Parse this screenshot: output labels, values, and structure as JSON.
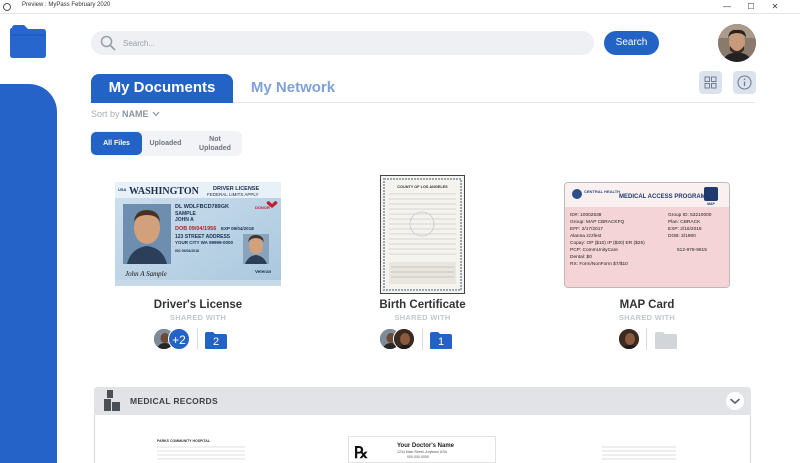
{
  "window": {
    "title": "Preview : MyPass February 2020",
    "minimize_glyph": "—",
    "maximize_glyph": "☐",
    "close_glyph": "✕"
  },
  "search": {
    "placeholder": "Search...",
    "value": "",
    "button_label": "Search"
  },
  "tabs": [
    {
      "label": "My Documents",
      "active": true
    },
    {
      "label": "My Network",
      "active": false
    }
  ],
  "sort": {
    "label": "Sort by",
    "value": "NAME"
  },
  "filters": [
    {
      "label": "All Files",
      "active": true
    },
    {
      "label": "Uploaded",
      "active": false
    },
    {
      "label": "Not Uploaded",
      "active": false
    }
  ],
  "documents": [
    {
      "title": "Driver's License",
      "shared_label": "SHARED WITH",
      "extra_shares": "+2",
      "folder_count": "2",
      "image_text": {
        "state": "WASHINGTON",
        "type": "DRIVER LICENSE",
        "sub": "FEDERAL LIMITS APPLY",
        "dl": "DL WDLFBCD789GK",
        "name1": "SAMPLE",
        "name2": "JOHN A",
        "dob": "DOB 09/04/1956",
        "exp": "EXP 09/04/2018",
        "addr1": "123 STREET ADDRESS",
        "addr2": "YOUR CITY WA 99999-0000",
        "donor": "DONOR",
        "veteran": "Veteran",
        "sig": "John A Sample",
        "iss": "ISS 09/04/2018"
      }
    },
    {
      "title": "Birth Certificate",
      "shared_label": "SHARED WITH",
      "folder_count": "1",
      "image_text": {
        "header": "COUNTY OF LOS ANGELES"
      }
    },
    {
      "title": "MAP Card",
      "shared_label": "SHARED WITH",
      "image_text": {
        "program": "MEDICAL ACCESS PROGRAM",
        "brand": "CENTRAL HEALTH",
        "badge": "MAP",
        "id": "ID#: 10002638",
        "group_id": "Group ID: 53210000",
        "group": "Group: MAP CBRACKFQ",
        "plan": "Plan: CBRACK",
        "eff": "EFF: 2/17/2017",
        "exp": "EXP: 2/16/2018",
        "name": "Alanna zzzfest",
        "dob": "DOB: 3/1980",
        "copay": "Copay: OP ($10) IP ($30) ER ($25)",
        "pcp": "PCP: CommUnityCare",
        "phone": "512-978-9615",
        "dental": "Dental: $0",
        "rx": "RX: Form/NonForm $7/$10"
      }
    }
  ],
  "medical_records": {
    "title": "MEDICAL RECORDS",
    "doc2_title": "Your Doctor's Name",
    "doc2_line1": "1234 Main Street, Anytown USA",
    "doc2_line2": "000-000-0000",
    "doc1_header": "PARKS COMMUNITY HOSPITAL"
  },
  "colors": {
    "primary": "#2363c6",
    "sidebar": "#2563c9",
    "tab_inactive": "#7fa0d8",
    "panel_header": "#e1e3e6"
  },
  "icons": {
    "app": "window-icon",
    "logo": "folder-icon",
    "search": "search-icon",
    "grid": "grid-icon",
    "info": "info-icon",
    "sort": "chevron-down-icon",
    "medical": "buildings-icon",
    "collapse": "chevron-down-icon"
  }
}
